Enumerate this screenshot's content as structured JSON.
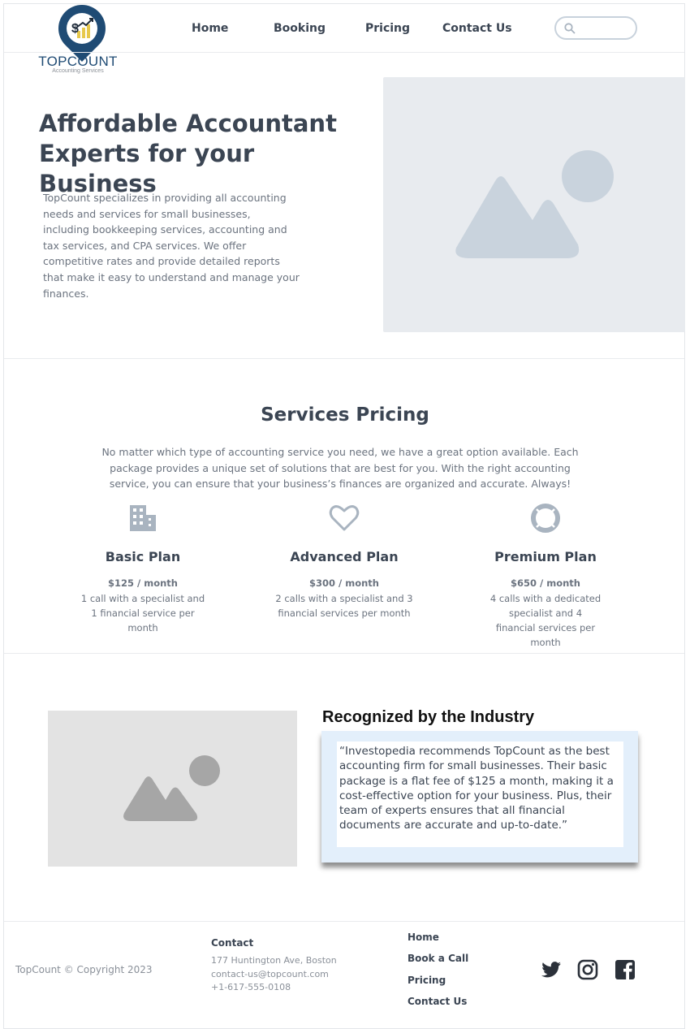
{
  "brand": {
    "name": "TOPCOUNT",
    "tagline": "Accounting Services",
    "color": "#1f4b74",
    "accent": "#e7c84b"
  },
  "nav": {
    "items": [
      "Home",
      "Booking",
      "Pricing",
      "Contact Us"
    ],
    "search_placeholder": ""
  },
  "hero": {
    "title": "Affordable Accountant Experts for your Business",
    "description": "TopCount specializes in providing all accounting needs and services for small businesses, including bookkeeping services, accounting and tax services, and CPA services. We offer competitive rates and provide detailed reports that make it easy to understand and manage your finances.",
    "image": "image-placeholder-icon"
  },
  "pricing": {
    "title": "Services Pricing",
    "description": "No matter which type of accounting service you need, we have a great option available. Each package provides a unique set of solutions that are best for you. With the right accounting service, you can ensure that your business’s finances are organized and accurate. Always!",
    "plans": [
      {
        "icon": "building-icon",
        "name": "Basic Plan",
        "price": "$125 / month",
        "description": "1 call with a specialist and 1 financial service per month"
      },
      {
        "icon": "heart-icon",
        "name": "Advanced Plan",
        "price": "$300 / month",
        "description": "2 calls with a specialist and 3 financial services per month"
      },
      {
        "icon": "lifebuoy-icon",
        "name": "Premium Plan",
        "price": "$650 / month",
        "description": "4 calls with a dedicated specialist and 4 financial services per month"
      }
    ]
  },
  "recognition": {
    "title": "Recognized by the Industry",
    "quote": "“Investopedia recommends TopCount as the best accounting firm for small businesses. Their basic package is a flat fee of $125 a month, making it a cost-effective option for your business. Plus, their team of experts ensures that all financial documents are accurate and up-to-date.”",
    "image": "image-placeholder-icon"
  },
  "footer": {
    "copyright": "TopCount © Copyright 2023",
    "contact_heading": "Contact",
    "address": "177 Huntington Ave, Boston",
    "email": "contact-us@topcount.com",
    "phone": "+1-617-555-0108",
    "links": [
      "Home",
      "Book a Call",
      "Pricing",
      "Contact Us"
    ],
    "social": [
      "twitter-icon",
      "instagram-icon",
      "facebook-icon"
    ]
  }
}
